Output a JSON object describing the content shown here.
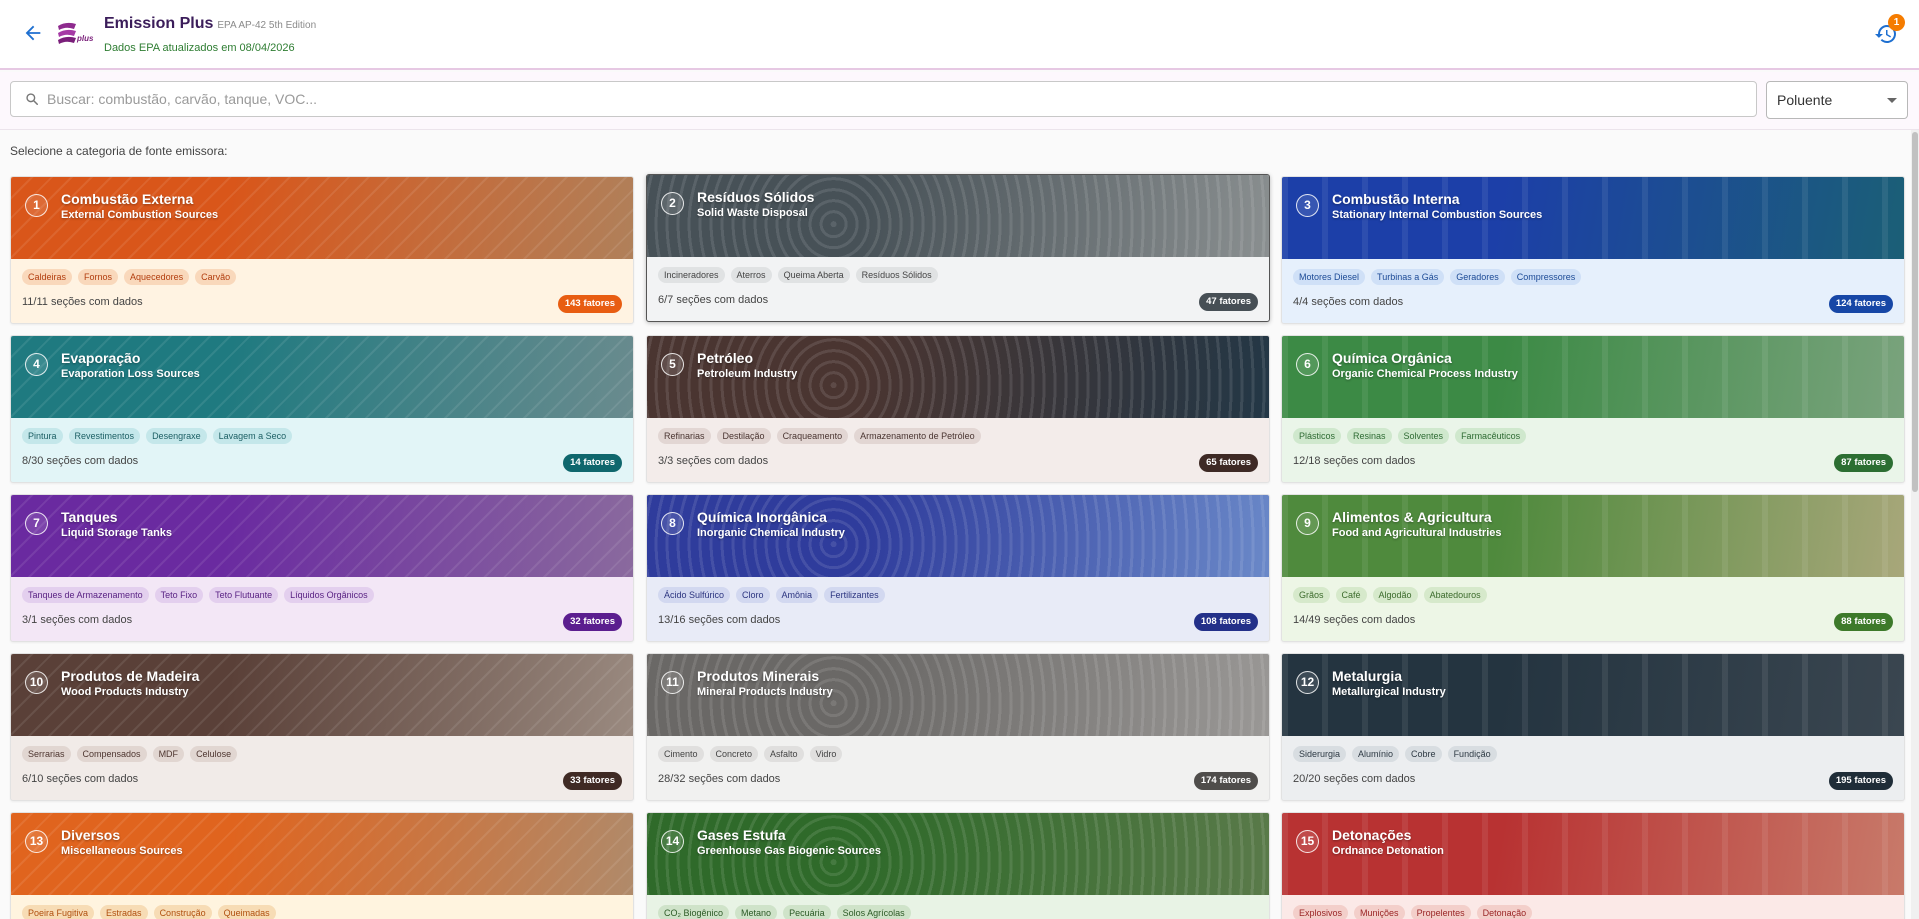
{
  "header": {
    "title": "Emission Plus",
    "edition": "EPA AP-42 5th Edition",
    "updated": "Dados EPA atualizados em 08/04/2026",
    "notification_count": "1",
    "logo_text": "plus"
  },
  "search": {
    "placeholder": "Buscar: combustão, carvão, tanque, VOC..."
  },
  "filter": {
    "value": "Poluente"
  },
  "section_label": "Selecione a categoria de fonte emissora:",
  "cards": [
    {
      "num": "1",
      "title": "Combustão Externa",
      "subtitle": "External Combustion Sources",
      "tags": [
        "Caldeiras",
        "Fornos",
        "Aquecedores",
        "Carvão"
      ],
      "sections": "11/11 seções com dados",
      "count": "143 fatores",
      "colors": {
        "banner1": "#d9561a",
        "banner2": "#b0805a",
        "body": "#fff3e2",
        "tag_bg": "#f9d8bb",
        "tag_fg": "#b23d0e",
        "badge": "#e85d12"
      }
    },
    {
      "num": "2",
      "title": "Resíduos Sólidos",
      "subtitle": "Solid Waste Disposal",
      "tags": [
        "Incineradores",
        "Aterros",
        "Queima Aberta",
        "Resíduos Sólidos"
      ],
      "sections": "6/7 seções com dados",
      "count": "47 fatores",
      "colors": {
        "banner1": "#475157",
        "banner2": "#8a8f90",
        "body": "#f2f3f4",
        "tag_bg": "#e0e2e3",
        "tag_fg": "#444",
        "badge": "#474f55"
      }
    },
    {
      "num": "3",
      "title": "Combustão Interna",
      "subtitle": "Stationary Internal Combustion Sources",
      "tags": [
        "Motores Diesel",
        "Turbinas a Gás",
        "Geradores",
        "Compressores"
      ],
      "sections": "4/4 seções com dados",
      "count": "124 fatores",
      "colors": {
        "banner1": "#1c3fa8",
        "banner2": "#1b5f76",
        "body": "#e6f0fc",
        "tag_bg": "#cfe0f7",
        "tag_fg": "#1c4a96",
        "badge": "#1747a6"
      }
    },
    {
      "num": "4",
      "title": "Evaporação",
      "subtitle": "Evaporation Loss Sources",
      "tags": [
        "Pintura",
        "Revestimentos",
        "Desengraxe",
        "Lavagem a Seco"
      ],
      "sections": "8/30 seções com dados",
      "count": "14 fatores",
      "colors": {
        "banner1": "#1f7a80",
        "banner2": "#6a8b8e",
        "body": "#e2f5f7",
        "tag_bg": "#c4e7ea",
        "tag_fg": "#1c5f64",
        "badge": "#0f676d"
      }
    },
    {
      "num": "5",
      "title": "Petróleo",
      "subtitle": "Petroleum Industry",
      "tags": [
        "Refinarias",
        "Destilação",
        "Craqueamento",
        "Armazenamento de Petróleo"
      ],
      "sections": "3/3 seções com dados",
      "count": "65 fatores",
      "colors": {
        "banner1": "#4a3531",
        "banner2": "#233746",
        "body": "#f3ecea",
        "tag_bg": "#e2d6d3",
        "tag_fg": "#4a3531",
        "badge": "#3e2a25"
      }
    },
    {
      "num": "6",
      "title": "Química Orgânica",
      "subtitle": "Organic Chemical Process Industry",
      "tags": [
        "Plásticos",
        "Resinas",
        "Solventes",
        "Farmacêuticos"
      ],
      "sections": "12/18 seções com dados",
      "count": "87 fatores",
      "colors": {
        "banner1": "#3c8a45",
        "banner2": "#7aa37d",
        "body": "#eaf5e9",
        "tag_bg": "#cfe8cd",
        "tag_fg": "#2e6b33",
        "badge": "#2c6e32"
      }
    },
    {
      "num": "7",
      "title": "Tanques",
      "subtitle": "Liquid Storage Tanks",
      "tags": [
        "Tanques de Armazenamento",
        "Teto Fixo",
        "Teto Flutuante",
        "Líquidos Orgânicos"
      ],
      "sections": "3/1 seções com dados",
      "count": "32 fatores",
      "colors": {
        "banner1": "#6a2aa0",
        "banner2": "#8a6a9e",
        "body": "#f3e7f6",
        "tag_bg": "#e3cfee",
        "tag_fg": "#5a2384",
        "badge": "#5b1e8f"
      }
    },
    {
      "num": "8",
      "title": "Química Inorgânica",
      "subtitle": "Inorganic Chemical Industry",
      "tags": [
        "Ácido Sulfúrico",
        "Cloro",
        "Amônia",
        "Fertilizantes"
      ],
      "sections": "13/16 seções com dados",
      "count": "108 fatores",
      "colors": {
        "banner1": "#2f3c9c",
        "banner2": "#6a88c8",
        "body": "#e8ebf7",
        "tag_bg": "#d2d8f0",
        "tag_fg": "#2b347f",
        "badge": "#233089"
      }
    },
    {
      "num": "9",
      "title": "Alimentos & Agricultura",
      "subtitle": "Food and Agricultural Industries",
      "tags": [
        "Grãos",
        "Café",
        "Algodão",
        "Abatedouros"
      ],
      "sections": "14/49 seções com dados",
      "count": "88 fatores",
      "colors": {
        "banner1": "#4f8a3d",
        "banner2": "#a8a77a",
        "body": "#edf6e6",
        "tag_bg": "#d6e9cb",
        "tag_fg": "#3c6b2c",
        "badge": "#3d7a2a"
      }
    },
    {
      "num": "10",
      "title": "Produtos de Madeira",
      "subtitle": "Wood Products Industry",
      "tags": [
        "Serrarias",
        "Compensados",
        "MDF",
        "Celulose"
      ],
      "sections": "6/10 seções com dados",
      "count": "33 fatores",
      "colors": {
        "banner1": "#5a4038",
        "banner2": "#9a8a80",
        "body": "#f1ebe8",
        "tag_bg": "#e1d6d1",
        "tag_fg": "#4e3630",
        "badge": "#3f2a24"
      }
    },
    {
      "num": "11",
      "title": "Produtos Minerais",
      "subtitle": "Mineral Products Industry",
      "tags": [
        "Cimento",
        "Concreto",
        "Asfalto",
        "Vidro"
      ],
      "sections": "28/32 seções com dados",
      "count": "174 fatores",
      "colors": {
        "banner1": "#6a6866",
        "banner2": "#9a9896",
        "body": "#f1f1f0",
        "tag_bg": "#e0dfde",
        "tag_fg": "#444",
        "badge": "#4f4d4b"
      }
    },
    {
      "num": "12",
      "title": "Metalurgia",
      "subtitle": "Metallurgical Industry",
      "tags": [
        "Siderurgia",
        "Alumínio",
        "Cobre",
        "Fundição"
      ],
      "sections": "20/20 seções com dados",
      "count": "195 fatores",
      "colors": {
        "banner1": "#243440",
        "banner2": "#3a4650",
        "body": "#eceef0",
        "tag_bg": "#d8dde1",
        "tag_fg": "#2e3a44",
        "badge": "#1f2d38"
      }
    },
    {
      "num": "13",
      "title": "Diversos",
      "subtitle": "Miscellaneous Sources",
      "tags": [
        "Poeira Fugitiva",
        "Estradas",
        "Construção",
        "Queimadas"
      ],
      "sections": "",
      "count": "",
      "colors": {
        "banner1": "#e0641e",
        "banner2": "#b08a6a",
        "body": "#fff4df",
        "tag_bg": "#f7dcb5",
        "tag_fg": "#b0500f",
        "badge": "#e06a12"
      }
    },
    {
      "num": "14",
      "title": "Gases Estufa",
      "subtitle": "Greenhouse Gas Biogenic Sources",
      "tags": [
        "CO₂ Biogênico",
        "Metano",
        "Pecuária",
        "Solos Agrícolas"
      ],
      "sections": "",
      "count": "",
      "colors": {
        "banner1": "#2f6a2a",
        "banner2": "#5a7a4a",
        "body": "#e8f3e5",
        "tag_bg": "#cfe3c9",
        "tag_fg": "#2c5a26",
        "badge": "#2b5f26"
      }
    },
    {
      "num": "15",
      "title": "Detonações",
      "subtitle": "Ordnance Detonation",
      "tags": [
        "Explosivos",
        "Munições",
        "Propelentes",
        "Detonação"
      ],
      "sections": "",
      "count": "",
      "colors": {
        "banner1": "#b83232",
        "banner2": "#c87a6a",
        "body": "#fbe9e7",
        "tag_bg": "#f3cfca",
        "tag_fg": "#9a2626",
        "badge": "#a82828"
      }
    }
  ]
}
